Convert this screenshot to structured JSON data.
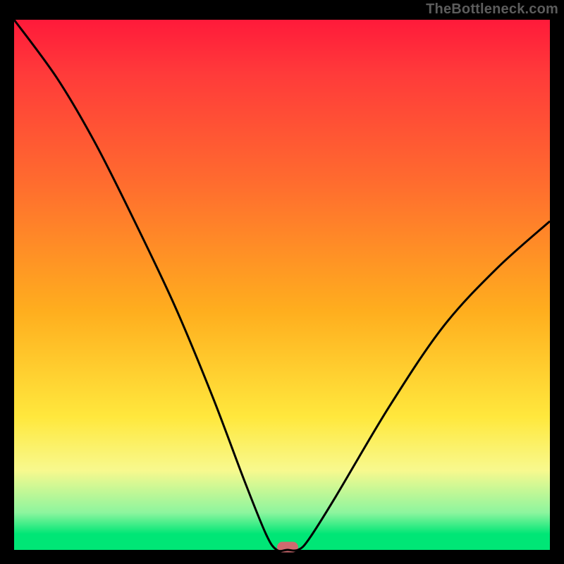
{
  "attribution": "TheBottleneck.com",
  "colors": {
    "frame_bg": "#000000",
    "curve_stroke": "#000000",
    "marker_fill": "#cf6a6f",
    "attribution_text": "#5c5c5c",
    "gradient_stops": [
      "#ff1a3a",
      "#ff3a3a",
      "#ff6a2f",
      "#ffae1e",
      "#ffe83d",
      "#f8f98e",
      "#8cf59e",
      "#00e676"
    ]
  },
  "chart_data": {
    "type": "line",
    "title": "",
    "xlabel": "",
    "ylabel": "",
    "xlim": [
      0,
      100
    ],
    "ylim": [
      0,
      100
    ],
    "series": [
      {
        "name": "bottleneck-curve",
        "x": [
          0,
          8,
          15,
          22,
          30,
          37,
          43,
          47,
          49,
          51,
          53,
          55,
          60,
          70,
          80,
          90,
          100
        ],
        "values": [
          100,
          89,
          77,
          63,
          46,
          29,
          13,
          3,
          0,
          0,
          0,
          2,
          10,
          27,
          42,
          53,
          62
        ]
      }
    ],
    "marker": {
      "x": 51,
      "y": 0
    },
    "annotations": []
  }
}
